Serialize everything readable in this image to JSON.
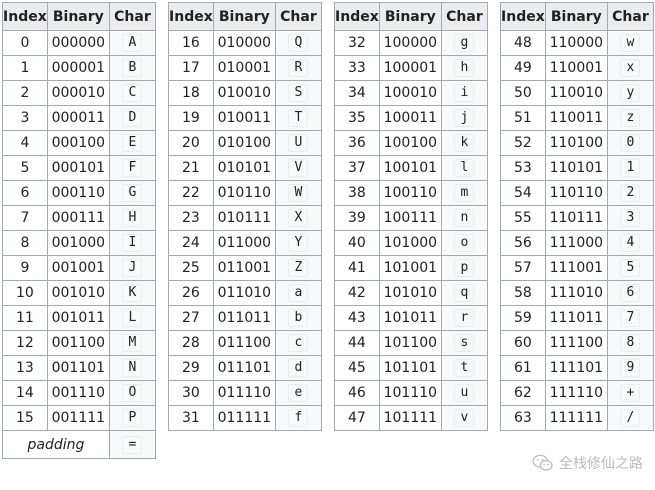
{
  "headers": {
    "index": "Index",
    "binary": "Binary",
    "char": "Char"
  },
  "columns": [
    {
      "rows": [
        [
          "0",
          "000000",
          "A"
        ],
        [
          "1",
          "000001",
          "B"
        ],
        [
          "2",
          "000010",
          "C"
        ],
        [
          "3",
          "000011",
          "D"
        ],
        [
          "4",
          "000100",
          "E"
        ],
        [
          "5",
          "000101",
          "F"
        ],
        [
          "6",
          "000110",
          "G"
        ],
        [
          "7",
          "000111",
          "H"
        ],
        [
          "8",
          "001000",
          "I"
        ],
        [
          "9",
          "001001",
          "J"
        ],
        [
          "10",
          "001010",
          "K"
        ],
        [
          "11",
          "001011",
          "L"
        ],
        [
          "12",
          "001100",
          "M"
        ],
        [
          "13",
          "001101",
          "N"
        ],
        [
          "14",
          "001110",
          "O"
        ],
        [
          "15",
          "001111",
          "P"
        ]
      ]
    },
    {
      "rows": [
        [
          "16",
          "010000",
          "Q"
        ],
        [
          "17",
          "010001",
          "R"
        ],
        [
          "18",
          "010010",
          "S"
        ],
        [
          "19",
          "010011",
          "T"
        ],
        [
          "20",
          "010100",
          "U"
        ],
        [
          "21",
          "010101",
          "V"
        ],
        [
          "22",
          "010110",
          "W"
        ],
        [
          "23",
          "010111",
          "X"
        ],
        [
          "24",
          "011000",
          "Y"
        ],
        [
          "25",
          "011001",
          "Z"
        ],
        [
          "26",
          "011010",
          "a"
        ],
        [
          "27",
          "011011",
          "b"
        ],
        [
          "28",
          "011100",
          "c"
        ],
        [
          "29",
          "011101",
          "d"
        ],
        [
          "30",
          "011110",
          "e"
        ],
        [
          "31",
          "011111",
          "f"
        ]
      ]
    },
    {
      "rows": [
        [
          "32",
          "100000",
          "g"
        ],
        [
          "33",
          "100001",
          "h"
        ],
        [
          "34",
          "100010",
          "i"
        ],
        [
          "35",
          "100011",
          "j"
        ],
        [
          "36",
          "100100",
          "k"
        ],
        [
          "37",
          "100101",
          "l"
        ],
        [
          "38",
          "100110",
          "m"
        ],
        [
          "39",
          "100111",
          "n"
        ],
        [
          "40",
          "101000",
          "o"
        ],
        [
          "41",
          "101001",
          "p"
        ],
        [
          "42",
          "101010",
          "q"
        ],
        [
          "43",
          "101011",
          "r"
        ],
        [
          "44",
          "101100",
          "s"
        ],
        [
          "45",
          "101101",
          "t"
        ],
        [
          "46",
          "101110",
          "u"
        ],
        [
          "47",
          "101111",
          "v"
        ]
      ]
    },
    {
      "rows": [
        [
          "48",
          "110000",
          "w"
        ],
        [
          "49",
          "110001",
          "x"
        ],
        [
          "50",
          "110010",
          "y"
        ],
        [
          "51",
          "110011",
          "z"
        ],
        [
          "52",
          "110100",
          "0"
        ],
        [
          "53",
          "110101",
          "1"
        ],
        [
          "54",
          "110110",
          "2"
        ],
        [
          "55",
          "110111",
          "3"
        ],
        [
          "56",
          "111000",
          "4"
        ],
        [
          "57",
          "111001",
          "5"
        ],
        [
          "58",
          "111010",
          "6"
        ],
        [
          "59",
          "111011",
          "7"
        ],
        [
          "60",
          "111100",
          "8"
        ],
        [
          "61",
          "111101",
          "9"
        ],
        [
          "62",
          "111110",
          "+"
        ],
        [
          "63",
          "111111",
          "/"
        ]
      ]
    }
  ],
  "padding": {
    "label": "padding",
    "char": "="
  },
  "watermark": {
    "text": "全栈修仙之路",
    "icon": "wechat-icon"
  }
}
